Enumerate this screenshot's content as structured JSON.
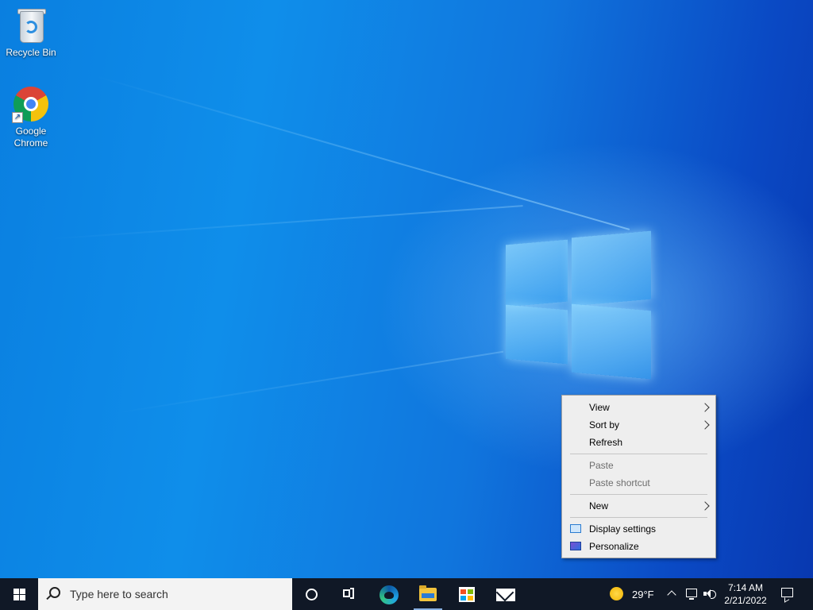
{
  "desktop": {
    "icons": [
      {
        "label": "Recycle Bin",
        "icon": "recycle-bin-icon"
      },
      {
        "label": "Google Chrome",
        "icon": "chrome-icon"
      }
    ]
  },
  "context_menu": {
    "items": [
      {
        "label": "View",
        "submenu": true,
        "enabled": true
      },
      {
        "label": "Sort by",
        "submenu": true,
        "enabled": true
      },
      {
        "label": "Refresh",
        "submenu": false,
        "enabled": true
      },
      {
        "label": "Paste",
        "submenu": false,
        "enabled": false
      },
      {
        "label": "Paste shortcut",
        "submenu": false,
        "enabled": false
      },
      {
        "label": "New",
        "submenu": true,
        "enabled": true
      },
      {
        "label": "Display settings",
        "submenu": false,
        "enabled": true,
        "icon": "display-icon"
      },
      {
        "label": "Personalize",
        "submenu": false,
        "enabled": true,
        "icon": "personalize-icon"
      }
    ]
  },
  "taskbar": {
    "search_placeholder": "Type here to search",
    "weather": {
      "temp": "29°F",
      "icon": "sun-icon"
    },
    "clock": {
      "time": "7:14 AM",
      "date": "2/21/2022"
    },
    "pinned": [
      "cortana-icon",
      "task-view-icon",
      "edge-icon",
      "file-explorer-icon",
      "store-icon",
      "mail-icon"
    ]
  },
  "colors": {
    "taskbar_bg": "#101826",
    "menu_bg": "#eeeeee",
    "wallpaper_blue": "#0f8eea"
  }
}
